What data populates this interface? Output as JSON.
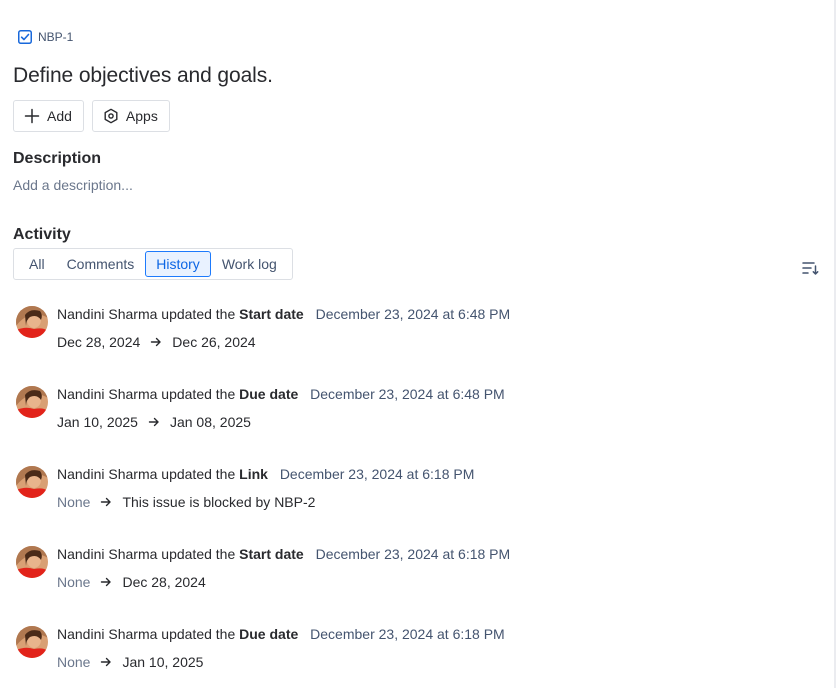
{
  "issue": {
    "key": "NBP-1",
    "title": "Define objectives and goals."
  },
  "actions": {
    "add_label": "Add",
    "apps_label": "Apps"
  },
  "description": {
    "heading": "Description",
    "placeholder": "Add a description..."
  },
  "activity": {
    "heading": "Activity",
    "tabs": [
      {
        "label": "All",
        "selected": false
      },
      {
        "label": "Comments",
        "selected": false
      },
      {
        "label": "History",
        "selected": true
      },
      {
        "label": "Work log",
        "selected": false
      }
    ]
  },
  "history": [
    {
      "user": "Nandini Sharma",
      "verb": "updated the",
      "field": "Start date",
      "when": "December 23, 2024 at 6:48 PM",
      "from": "Dec 28, 2024",
      "to": "Dec 26, 2024"
    },
    {
      "user": "Nandini Sharma",
      "verb": "updated the",
      "field": "Due date",
      "when": "December 23, 2024 at 6:48 PM",
      "from": "Jan 10, 2025",
      "to": "Jan 08, 2025"
    },
    {
      "user": "Nandini Sharma",
      "verb": "updated the",
      "field": "Link",
      "when": "December 23, 2024 at 6:18 PM",
      "from": "None",
      "to": "This issue is blocked by NBP-2"
    },
    {
      "user": "Nandini Sharma",
      "verb": "updated the",
      "field": "Start date",
      "when": "December 23, 2024 at 6:18 PM",
      "from": "None",
      "to": "Dec 28, 2024"
    },
    {
      "user": "Nandini Sharma",
      "verb": "updated the",
      "field": "Due date",
      "when": "December 23, 2024 at 6:18 PM",
      "from": "None",
      "to": "Jan 10, 2025"
    }
  ],
  "icons": {
    "issue_type": "checkbox-task-icon",
    "add": "plus-icon",
    "apps": "hexagon-apps-icon",
    "sort": "sort-icon",
    "arrow": "arrow-right-icon"
  },
  "colors": {
    "accent": "#0c66e4",
    "selected_bg": "#e9f2ff",
    "task_icon": "#1868db"
  }
}
